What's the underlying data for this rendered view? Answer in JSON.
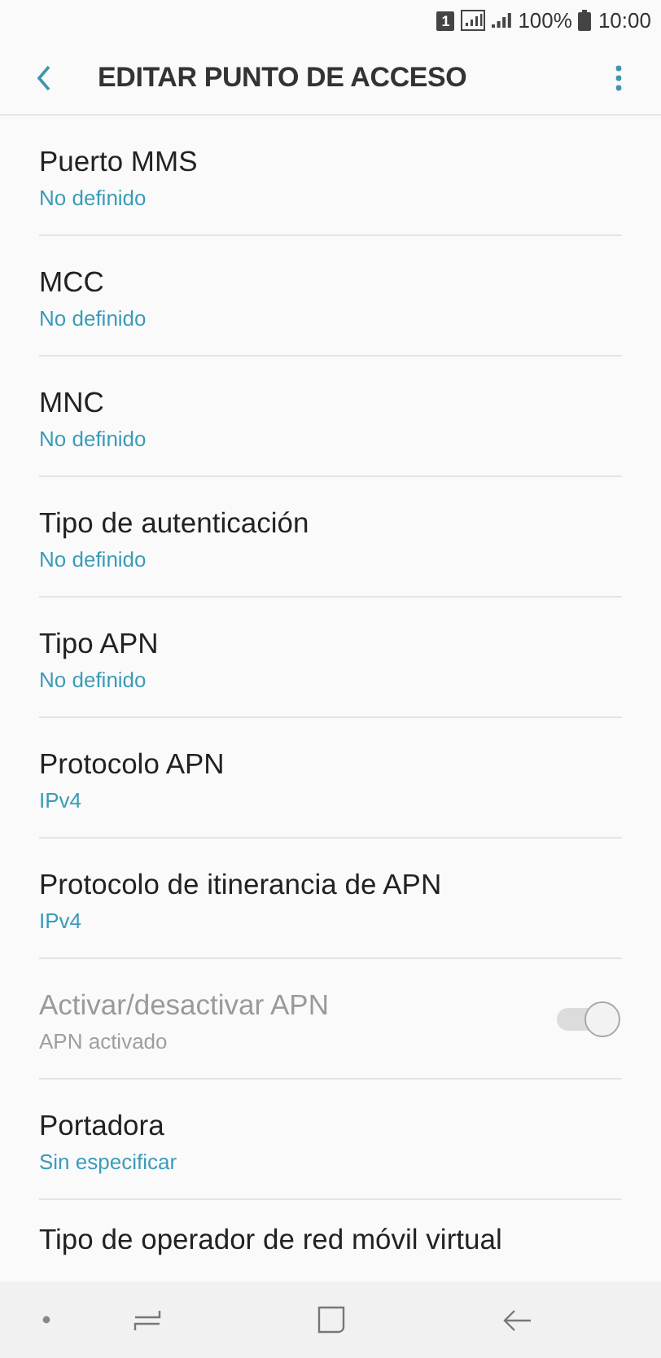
{
  "status_bar": {
    "sim_label": "1",
    "battery_text": "100%",
    "time": "10:00"
  },
  "header": {
    "title": "EDITAR PUNTO DE ACCESO"
  },
  "settings": [
    {
      "kind": "text",
      "title": "Puerto MMS",
      "value": "No definido",
      "disabled": false
    },
    {
      "kind": "text",
      "title": "MCC",
      "value": "No definido",
      "disabled": false
    },
    {
      "kind": "text",
      "title": "MNC",
      "value": "No definido",
      "disabled": false
    },
    {
      "kind": "text",
      "title": "Tipo de autenticación",
      "value": "No definido",
      "disabled": false
    },
    {
      "kind": "text",
      "title": "Tipo APN",
      "value": "No definido",
      "disabled": false
    },
    {
      "kind": "text",
      "title": "Protocolo APN",
      "value": "IPv4",
      "disabled": false
    },
    {
      "kind": "text",
      "title": "Protocolo de itinerancia de APN",
      "value": "IPv4",
      "disabled": false
    },
    {
      "kind": "toggle",
      "title": "Activar/desactivar APN",
      "value": "APN activado",
      "disabled": true,
      "on": true
    },
    {
      "kind": "text",
      "title": "Portadora",
      "value": "Sin especificar",
      "disabled": false
    },
    {
      "kind": "text",
      "title": "Tipo de operador de red móvil virtual",
      "disabled": false
    }
  ]
}
